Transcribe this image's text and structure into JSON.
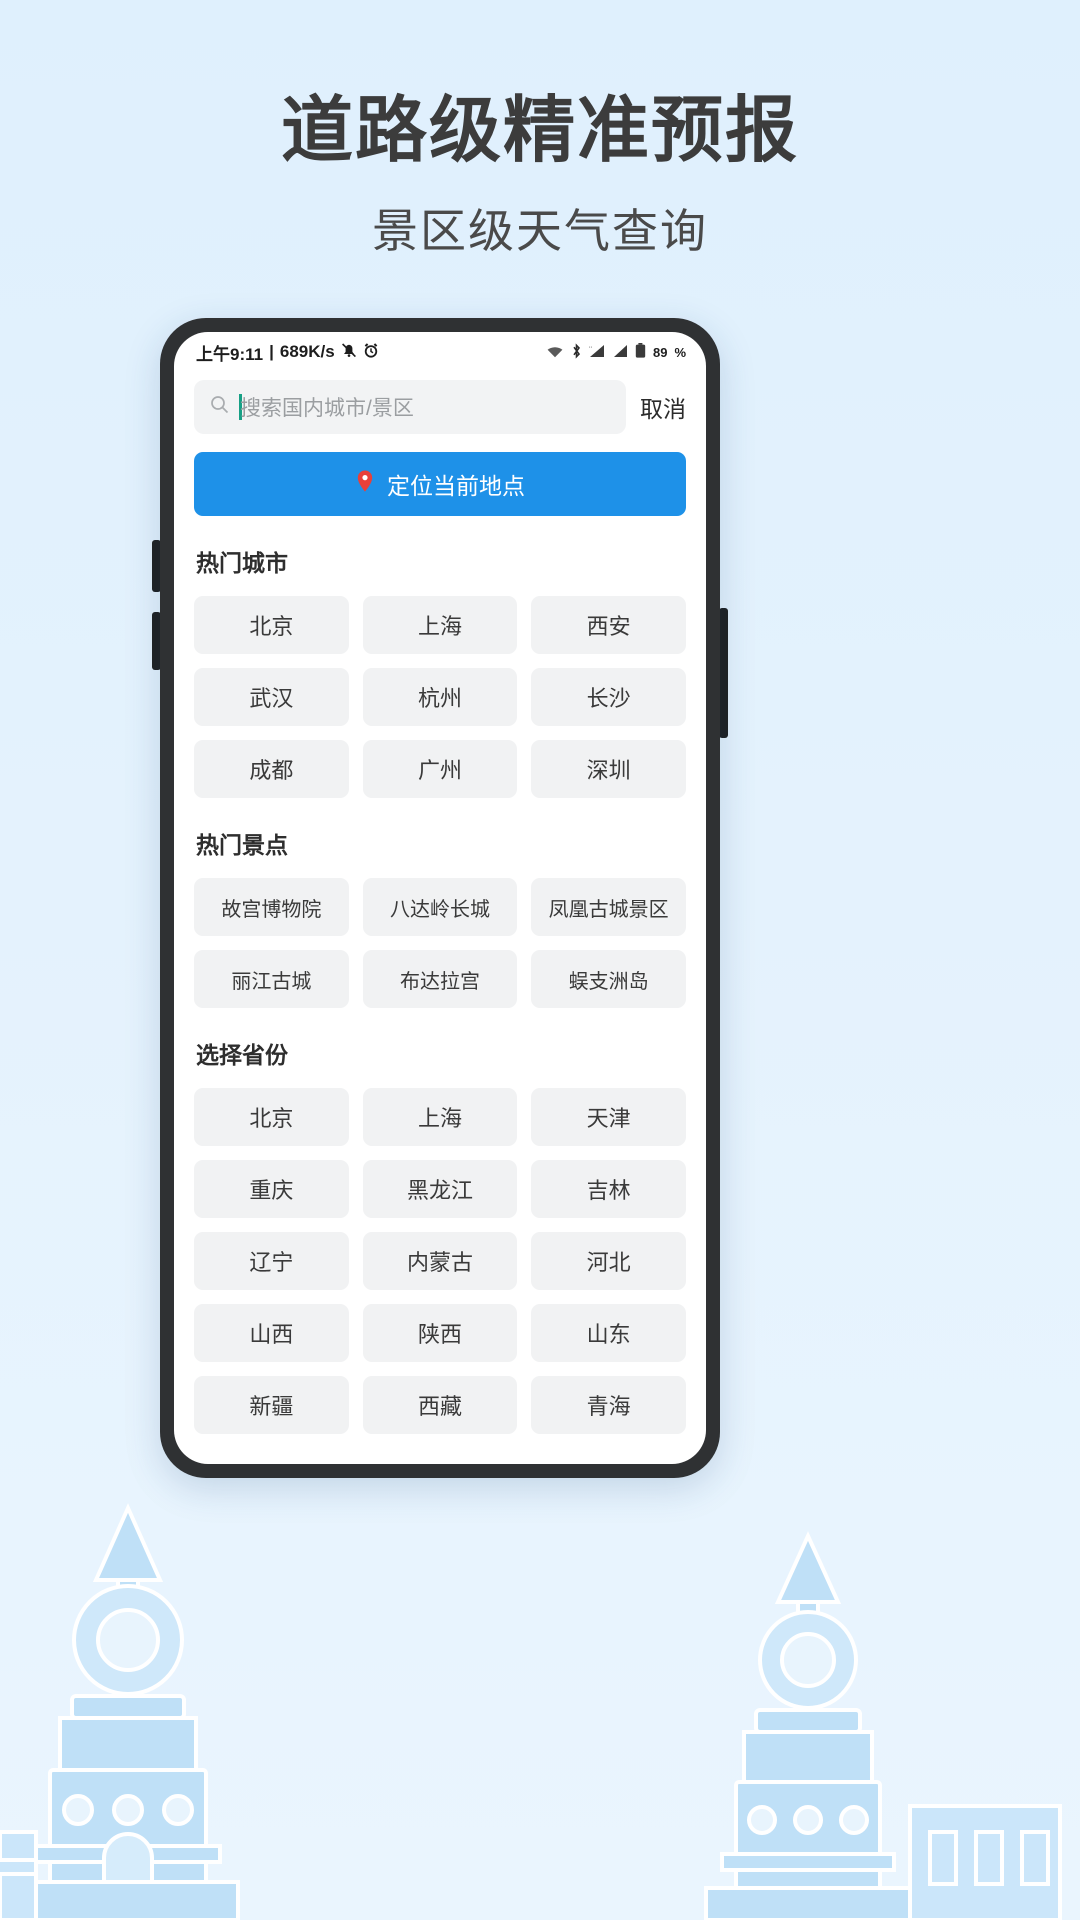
{
  "page": {
    "main_title": "道路级精准预报",
    "sub_title": "景区级天气查询",
    "background_color": "#dff0fd",
    "accent_color": "#1e91e8"
  },
  "status_bar": {
    "time": "上午9:11",
    "separator": "|",
    "network_speed": "689K/s",
    "mute_icon": "mute-bell-icon",
    "alarm_icon": "alarm-clock-icon",
    "wifi_icon": "wifi-icon",
    "bluetooth_icon": "bluetooth-icon",
    "signal_icon": "signal-bars-icon",
    "signal_icon_2": "signal-bars-icon",
    "battery_icon": "battery-icon",
    "battery_percent": "89",
    "battery_unit": "%"
  },
  "search": {
    "icon": "search-icon",
    "placeholder": "搜索国内城市/景区",
    "value": "",
    "cancel_label": "取消"
  },
  "locate": {
    "icon": "location-pin-icon",
    "label": "定位当前地点"
  },
  "sections": [
    {
      "title": "热门城市",
      "name": "hot-cities",
      "items": [
        "北京",
        "上海",
        "西安",
        "武汉",
        "杭州",
        "长沙",
        "成都",
        "广州",
        "深圳"
      ]
    },
    {
      "title": "热门景点",
      "name": "hot-attractions",
      "items": [
        "故宫博物院",
        "八达岭长城",
        "凤凰古城景区",
        "丽江古城",
        "布达拉宫",
        "蜈支洲岛"
      ]
    },
    {
      "title": "选择省份",
      "name": "select-province",
      "items": [
        "北京",
        "上海",
        "天津",
        "重庆",
        "黑龙江",
        "吉林",
        "辽宁",
        "内蒙古",
        "河北",
        "山西",
        "陕西",
        "山东",
        "新疆",
        "西藏",
        "青海"
      ]
    }
  ]
}
